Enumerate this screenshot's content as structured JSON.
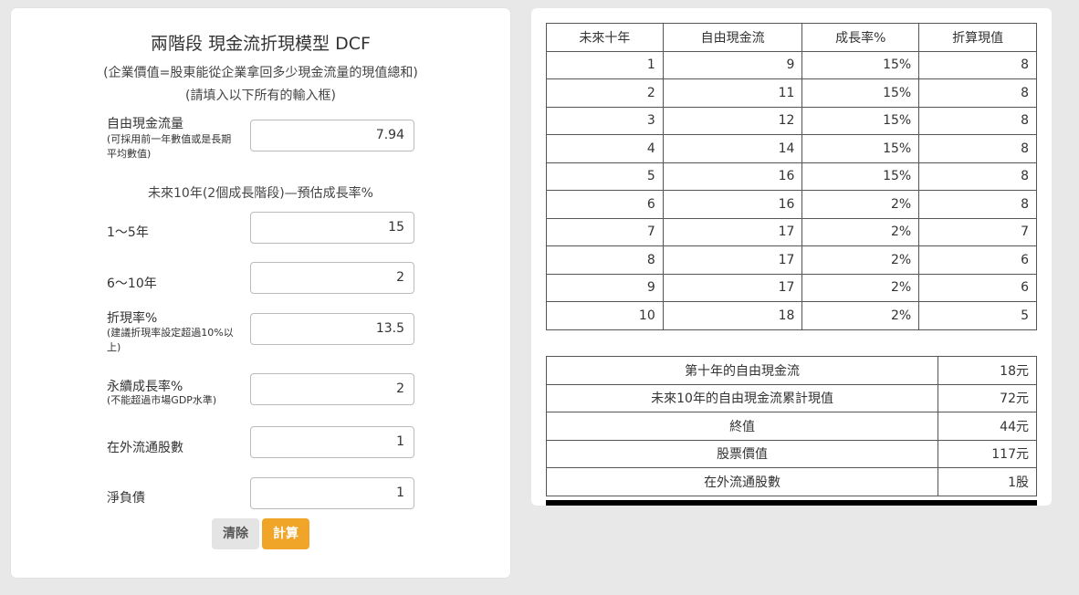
{
  "form": {
    "title": "兩階段 現金流折現模型 DCF",
    "subtitle1": "(企業價值=股東能從企業拿回多少現金流量的現值總和)",
    "subtitle2": "(請填入以下所有的輸入框)",
    "fcf_label": "自由現金流量",
    "fcf_note_line1": "(可採用前一年數值或是長期",
    "fcf_note_line2": "平均數值)",
    "fcf_value": "7.94",
    "growth_heading": "未來10年(2個成長階段)—預估成長率%",
    "g1_label": "1～5年",
    "g1_value": "15",
    "g2_label": "6～10年",
    "g2_value": "2",
    "discount_label": "折現率%",
    "discount_note_line1": "(建議折現率設定超過10%以",
    "discount_note_line2": "上)",
    "discount_value": "13.5",
    "perp_label": "永續成長率%",
    "perp_note": "(不能超過市場GDP水準)",
    "perp_value": "2",
    "shares_label": "在外流通股數",
    "shares_value": "1",
    "debt_label": "淨負債",
    "debt_value": "1",
    "clear_label": "清除",
    "calc_label": "計算"
  },
  "projection_table": {
    "headers": [
      "未來十年",
      "自由現金流",
      "成長率%",
      "折算現值"
    ],
    "rows": [
      [
        "1",
        "9",
        "15%",
        "8"
      ],
      [
        "2",
        "11",
        "15%",
        "8"
      ],
      [
        "3",
        "12",
        "15%",
        "8"
      ],
      [
        "4",
        "14",
        "15%",
        "8"
      ],
      [
        "5",
        "16",
        "15%",
        "8"
      ],
      [
        "6",
        "16",
        "2%",
        "8"
      ],
      [
        "7",
        "17",
        "2%",
        "7"
      ],
      [
        "8",
        "17",
        "2%",
        "6"
      ],
      [
        "9",
        "17",
        "2%",
        "6"
      ],
      [
        "10",
        "18",
        "2%",
        "5"
      ]
    ]
  },
  "summary_table": {
    "rows": [
      [
        "第十年的自由現金流",
        "18元"
      ],
      [
        "未來10年的自由現金流累計現值",
        "72元"
      ],
      [
        "終值",
        "44元"
      ],
      [
        "股票價值",
        "117元"
      ],
      [
        "在外流通股數",
        "1股"
      ]
    ]
  },
  "colors": {
    "calc_button": "#f0a428",
    "clear_button": "#e4e4e4",
    "background": "#e8e8e8"
  }
}
